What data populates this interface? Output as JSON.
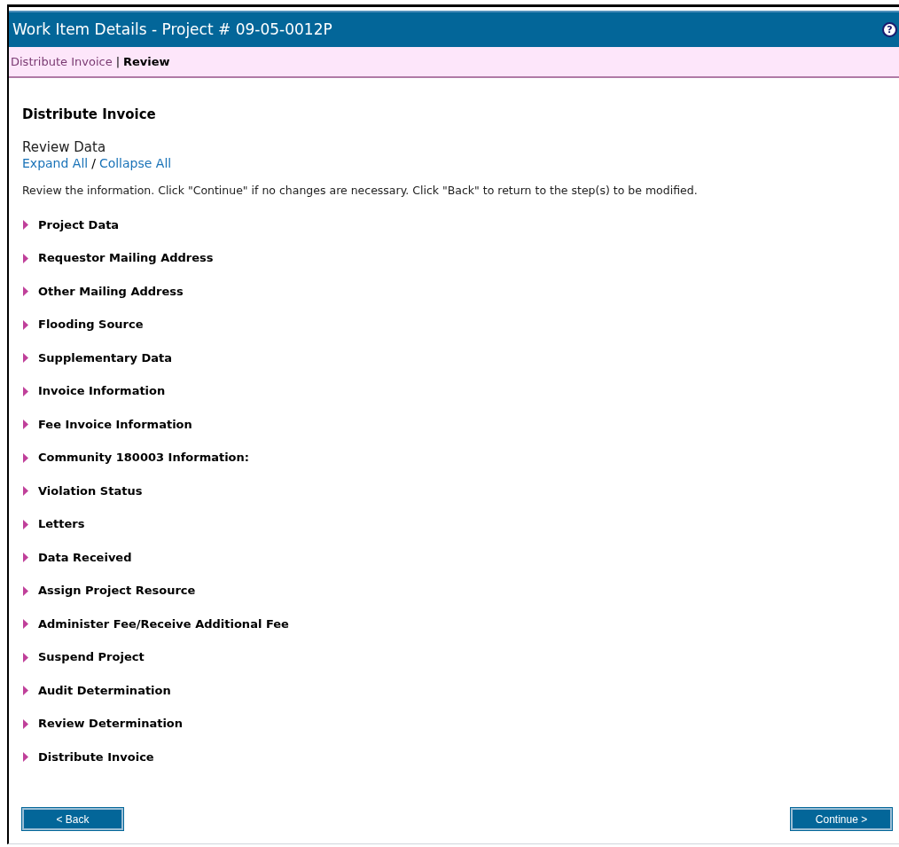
{
  "window": {
    "title": "Work Item Details - Project # 09-05-0012P",
    "help": "?"
  },
  "breadcrumb": [
    {
      "label": "Distribute Invoice",
      "selected": false
    },
    {
      "label": "Review",
      "selected": true
    }
  ],
  "breadcrumb_separator": "|",
  "heading": "Distribute Invoice",
  "subheading": "Review Data",
  "links": [
    "Expand All",
    "Collapse All"
  ],
  "link_separator": "/",
  "instructions": "Review the information. Click \"Continue\" if no changes are necessary. Click \"Back\" to return to the step(s) to be modified.",
  "sections": [
    {
      "label": "Project Data",
      "expanded": false
    },
    {
      "label": "Requestor Mailing Address",
      "expanded": false
    },
    {
      "label": "Other Mailing Address",
      "expanded": false
    },
    {
      "label": "Flooding Source",
      "expanded": false
    },
    {
      "label": "Supplementary Data",
      "expanded": false
    },
    {
      "label": "Invoice Information",
      "expanded": false
    },
    {
      "label": "Fee Invoice Information",
      "expanded": false
    },
    {
      "label": "Community 180003 Information:",
      "expanded": false
    },
    {
      "label": "Violation Status",
      "expanded": false
    },
    {
      "label": "Letters",
      "expanded": false
    },
    {
      "label": "Data Received",
      "expanded": false
    },
    {
      "label": "Assign Project Resource",
      "expanded": false
    },
    {
      "label": "Administer Fee/Receive Additional Fee",
      "expanded": false
    },
    {
      "label": "Suspend Project",
      "expanded": false
    },
    {
      "label": "Audit Determination",
      "expanded": false
    },
    {
      "label": "Review Determination",
      "expanded": false
    },
    {
      "label": "Distribute Invoice",
      "expanded": false
    }
  ],
  "buttons": {
    "back": "< Back",
    "continue": "Continue >"
  }
}
